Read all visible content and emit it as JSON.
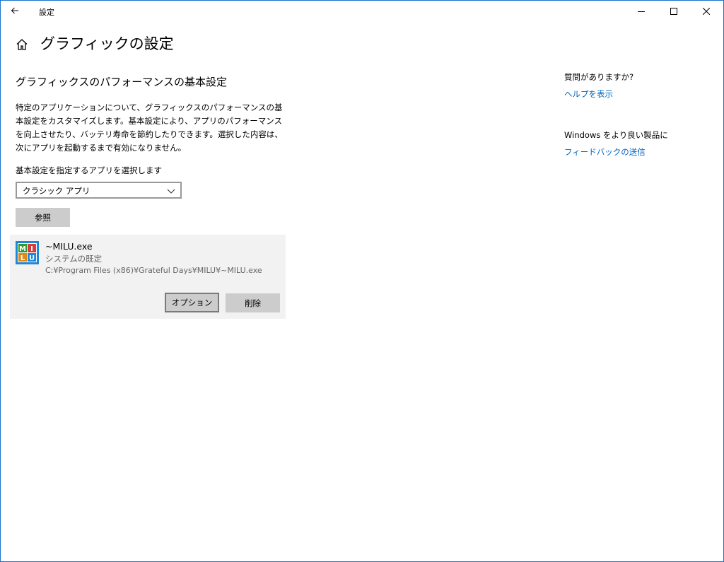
{
  "window": {
    "title": "設定"
  },
  "page": {
    "title": "グラフィックの設定"
  },
  "section": {
    "title": "グラフィックスのパフォーマンスの基本設定",
    "description": "特定のアプリケーションについて、グラフィックスのパフォーマンスの基本設定をカスタマイズします。基本設定により、アプリのパフォーマンスを向上させたり、バッテリ寿命を節約したりできます。選択した内容は、次にアプリを起動するまで有効になりません。",
    "select_label": "基本設定を指定するアプリを選択します",
    "dropdown_value": "クラシック アプリ",
    "browse_label": "参照"
  },
  "app": {
    "name": "~MILU.exe",
    "setting": "システムの既定",
    "path": "C:¥Program Files (x86)¥Grateful Days¥MILU¥~MILU.exe",
    "icon_letters": [
      "M",
      "I",
      "L",
      "U"
    ],
    "options_label": "オプション",
    "remove_label": "削除"
  },
  "sidebar": {
    "help_question": "質問がありますか?",
    "help_link": "ヘルプを表示",
    "feedback_title": "Windows をより良い製品に",
    "feedback_link": "フィードバックの送信"
  },
  "colors": {
    "accent": "#0067c0",
    "window_border": "#1a73d0",
    "card_bg": "#f2f2f2",
    "button_bg": "#cccccc"
  }
}
